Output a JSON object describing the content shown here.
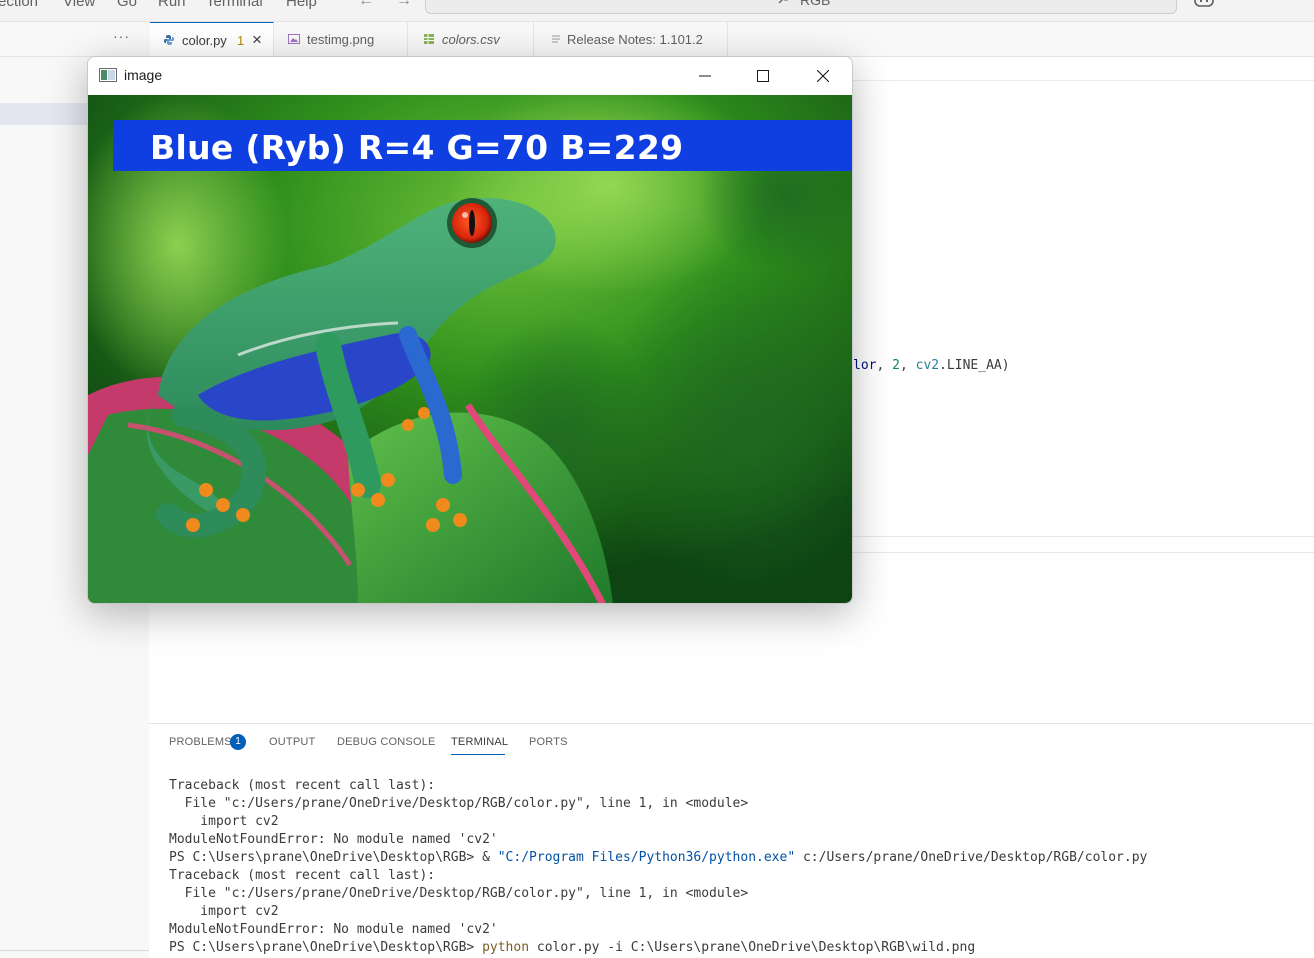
{
  "menu": {
    "items": [
      "ection",
      "View",
      "Go",
      "Run",
      "Terminal",
      "Help"
    ],
    "search_text": "RGB"
  },
  "tabs": [
    {
      "label": "color.py",
      "badge": "1",
      "close": "×",
      "icon": "python-file-icon",
      "active": true
    },
    {
      "label": "testimg.png",
      "icon": "image-file-icon",
      "active": false
    },
    {
      "label": "colors.csv",
      "icon": "csv-file-icon",
      "active": false
    },
    {
      "label": "Release Notes: 1.101.2",
      "icon": "notes-icon",
      "active": false
    }
  ],
  "tab_overflow": "···",
  "editor": {
    "code_fragment": {
      "part1": "lor",
      "part2": ", ",
      "part3": "2",
      "part4": ", ",
      "part5": "cv2",
      "part6": ".LINE_AA)"
    }
  },
  "image_window": {
    "title": "image",
    "banner_text": "Blue (Ryb) R=4 G=70 B=229",
    "banner_color": "#0f3fe0"
  },
  "panel": {
    "tabs": [
      "PROBLEMS",
      "OUTPUT",
      "DEBUG CONSOLE",
      "TERMINAL",
      "PORTS"
    ],
    "problems_count": "1",
    "active_tab": "TERMINAL",
    "terminal": {
      "l1": "Traceback (most recent call last):",
      "l2": "  File \"c:/Users/prane/OneDrive/Desktop/RGB/color.py\", line 1, in <module>",
      "l3": "    import cv2",
      "l4": "ModuleNotFoundError: No module named 'cv2'",
      "l5a": "PS C:\\Users\\prane\\OneDrive\\Desktop\\RGB> & ",
      "l5b": "\"C:/Program Files/Python36/python.exe\"",
      "l5c": " c:/Users/prane/OneDrive/Desktop/RGB/color.py",
      "l6": "Traceback (most recent call last):",
      "l7": "  File \"c:/Users/prane/OneDrive/Desktop/RGB/color.py\", line 1, in <module>",
      "l8": "    import cv2",
      "l9": "ModuleNotFoundError: No module named 'cv2'",
      "l10a": "PS C:\\Users\\prane\\OneDrive\\Desktop\\RGB> ",
      "l10b": "python",
      "l10c": " color.py -i C:\\Users\\prane\\OneDrive\\Desktop\\RGB\\wild.png"
    }
  }
}
